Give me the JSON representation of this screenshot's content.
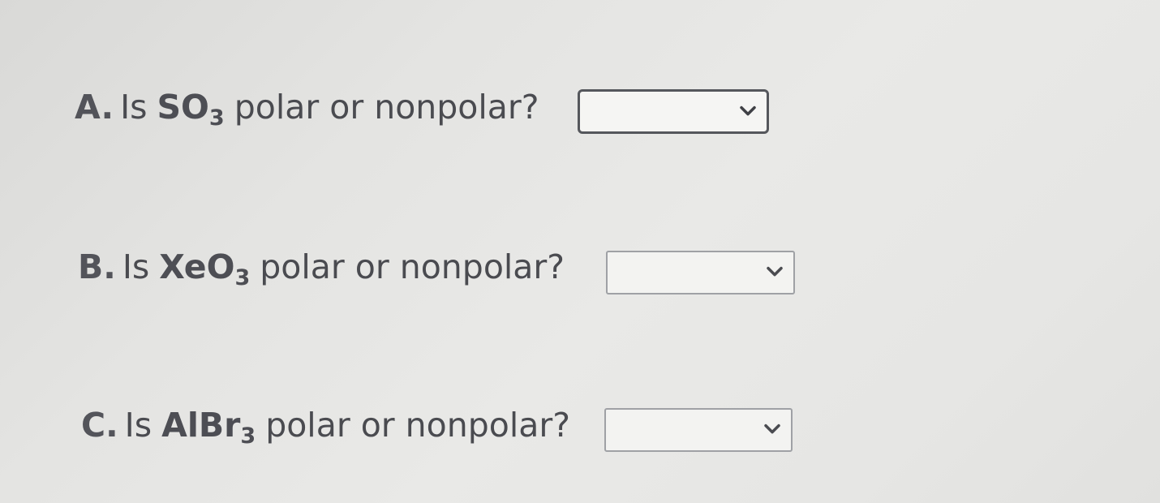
{
  "questions": [
    {
      "letter": "A.",
      "prefix": "Is",
      "formula_base": "SO",
      "formula_sub": "3",
      "suffix": "polar or nonpolar?",
      "selected_value": "",
      "focused": true,
      "icon": "chevron-down-icon"
    },
    {
      "letter": "B.",
      "prefix": "Is",
      "formula_base": "XeO",
      "formula_sub": "3",
      "suffix": "polar or nonpolar?",
      "selected_value": "",
      "focused": false,
      "icon": "chevron-down-icon"
    },
    {
      "letter": "C.",
      "prefix": "Is",
      "formula_base": "AlBr",
      "formula_sub": "3",
      "suffix": "polar or nonpolar?",
      "selected_value": "",
      "focused": false,
      "icon": "chevron-down-icon"
    }
  ]
}
